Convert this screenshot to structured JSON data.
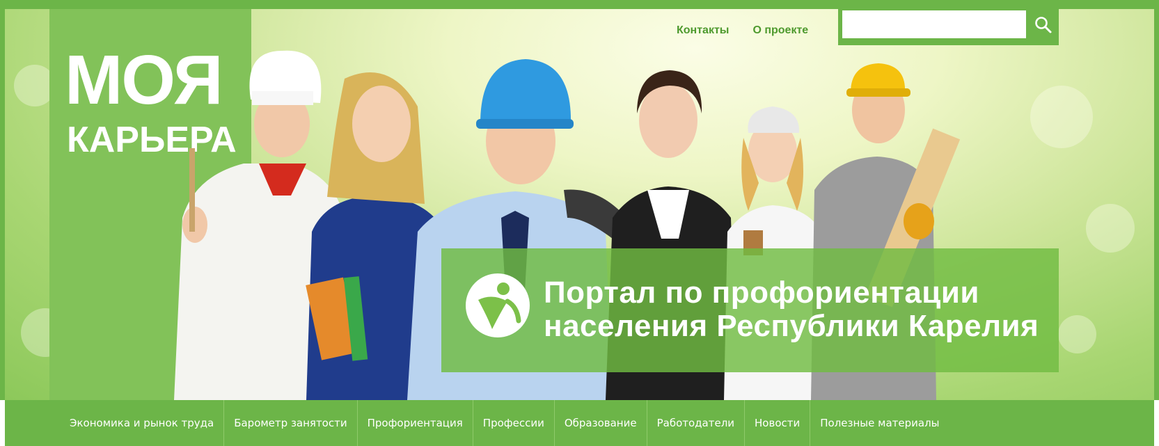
{
  "logo": {
    "line1": "МОЯ",
    "line2": "КАРЬЕРА"
  },
  "header": {
    "links": [
      "Контакты",
      "О проекте"
    ]
  },
  "search": {
    "value": "",
    "placeholder": "",
    "icon": "search-icon"
  },
  "tagline": {
    "line1": "Портал по профориентации",
    "line2": "населения Республики Карелия",
    "emblem": "person-emblem-icon"
  },
  "nav": {
    "items": [
      "Экономика и рынок труда",
      "Барометр занятости",
      "Профориентация",
      "Профессии",
      "Образование",
      "Работодатели",
      "Новости",
      "Полезные материалы"
    ]
  },
  "colors": {
    "brand_green": "#6cb548",
    "logo_green": "#82c259",
    "link_green": "#4e9a2e",
    "text_white": "#ffffff"
  }
}
